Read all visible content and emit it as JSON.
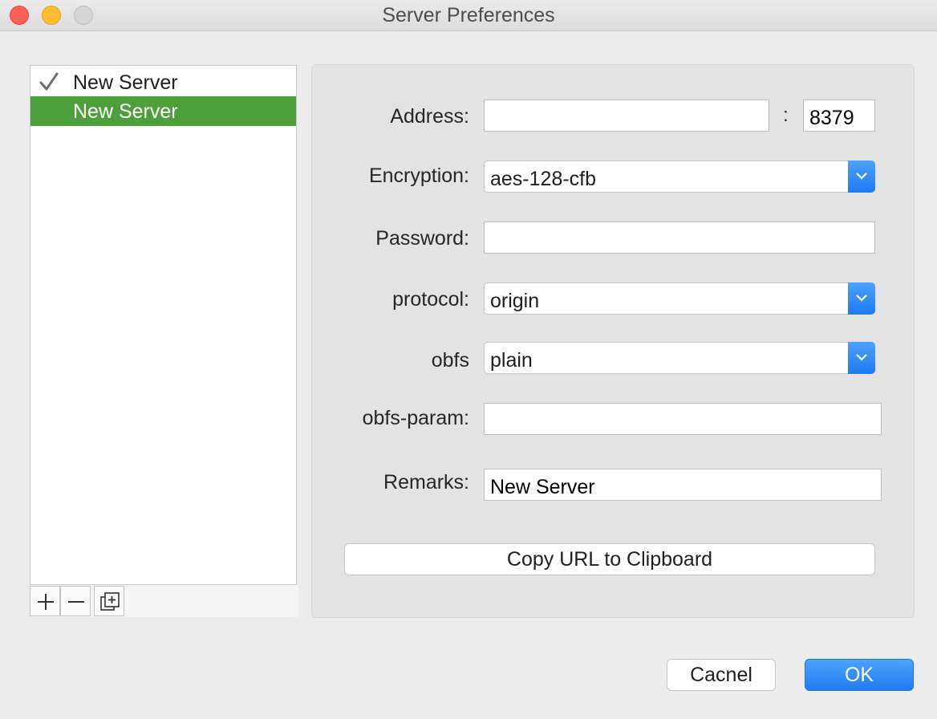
{
  "window": {
    "title": "Server Preferences"
  },
  "server_list": {
    "items": [
      {
        "label": "New Server",
        "active": true,
        "selected": false
      },
      {
        "label": "New Server",
        "active": false,
        "selected": true
      }
    ],
    "toolbar_icons": [
      "plus-icon",
      "minus-icon",
      "duplicate-icon"
    ]
  },
  "form": {
    "address_label": "Address:",
    "address_value": "",
    "port_separator": ":",
    "port_value": "8379",
    "encryption_label": "Encryption:",
    "encryption_value": "aes-128-cfb",
    "password_label": "Password:",
    "password_value": "",
    "protocol_label": "protocol:",
    "protocol_value": "origin",
    "obfs_label": "obfs",
    "obfs_value": "plain",
    "obfs_param_label": "obfs-param:",
    "obfs_param_value": "",
    "remarks_label": "Remarks:",
    "remarks_value": "New Server",
    "copy_url_label": "Copy URL to Clipboard"
  },
  "footer": {
    "cancel_label": "Cacnel",
    "ok_label": "OK"
  },
  "colors": {
    "selection": "#4c9f3a",
    "accent": "#1f7cf2"
  }
}
